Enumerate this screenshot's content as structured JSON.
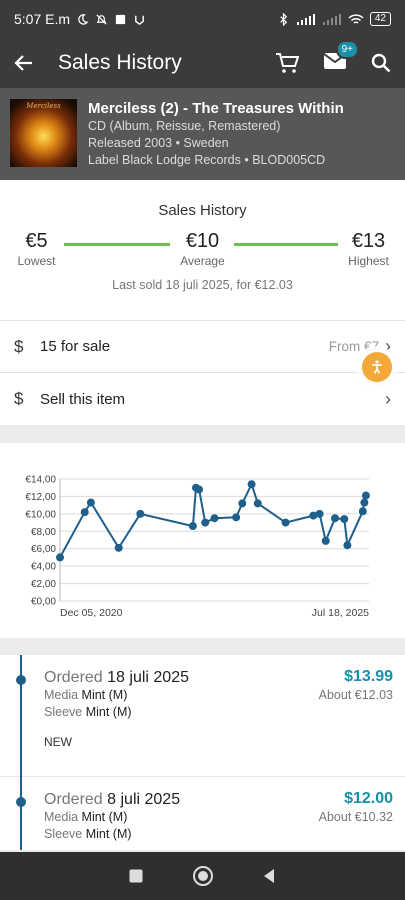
{
  "status_bar": {
    "time": "5:07 E.m",
    "battery": "42"
  },
  "app_bar": {
    "title": "Sales History",
    "cart_icon": "cart-icon",
    "inbox_icon": "inbox-icon",
    "inbox_badge": "9+",
    "search_icon": "search-icon",
    "back_icon": "back-arrow-icon"
  },
  "release": {
    "cover_logo": "Merciless",
    "title": "Merciless (2) - The Treasures Within",
    "format": "CD (Album, Reissue, Remastered)",
    "released": "Released 2003  • Sweden",
    "label": "Label Black Lodge Records • BLOD005CD"
  },
  "summary": {
    "heading": "Sales History",
    "lowest_value": "€5",
    "lowest_label": "Lowest",
    "average_value": "€10",
    "average_label": "Average",
    "highest_value": "€13",
    "highest_label": "Highest",
    "last_sold": "Last sold 18 juli 2025, for €12.03"
  },
  "rows": {
    "for_sale_icon": "$",
    "for_sale_label": "15 for sale",
    "for_sale_right": "From €7",
    "sell_icon": "$",
    "sell_label": "Sell this item"
  },
  "accent": "#1a8fa8",
  "chart_data": {
    "type": "line",
    "title": "",
    "xlabel": "",
    "ylabel": "",
    "x_tick_labels": [
      "Dec 05, 2020",
      "Jul 18, 2025"
    ],
    "y_tick_labels": [
      "€0,00",
      "€2,00",
      "€4,00",
      "€6,00",
      "€8,00",
      "€10,00",
      "€12,00",
      "€14,00"
    ],
    "ylim": [
      0,
      14
    ],
    "grid": true,
    "color": "#1f5f8b",
    "points": [
      {
        "x": 0.0,
        "y": 5.0
      },
      {
        "x": 0.08,
        "y": 10.2
      },
      {
        "x": 0.1,
        "y": 11.3
      },
      {
        "x": 0.19,
        "y": 6.1
      },
      {
        "x": 0.26,
        "y": 10.0
      },
      {
        "x": 0.43,
        "y": 8.6
      },
      {
        "x": 0.44,
        "y": 13.0
      },
      {
        "x": 0.45,
        "y": 12.8
      },
      {
        "x": 0.47,
        "y": 9.0
      },
      {
        "x": 0.5,
        "y": 9.5
      },
      {
        "x": 0.57,
        "y": 9.6
      },
      {
        "x": 0.59,
        "y": 11.2
      },
      {
        "x": 0.62,
        "y": 13.4
      },
      {
        "x": 0.64,
        "y": 11.2
      },
      {
        "x": 0.73,
        "y": 9.0
      },
      {
        "x": 0.82,
        "y": 9.8
      },
      {
        "x": 0.84,
        "y": 10.0
      },
      {
        "x": 0.86,
        "y": 6.9
      },
      {
        "x": 0.89,
        "y": 9.5
      },
      {
        "x": 0.92,
        "y": 9.4
      },
      {
        "x": 0.93,
        "y": 6.4
      },
      {
        "x": 0.98,
        "y": 10.3
      },
      {
        "x": 0.985,
        "y": 11.3
      },
      {
        "x": 0.99,
        "y": 12.1
      }
    ]
  },
  "orders": [
    {
      "ordered_label": "Ordered",
      "date": "18 juli 2025",
      "price_usd": "$13.99",
      "price_eur": "About €12.03",
      "media_label": "Media",
      "media": "Mint (M)",
      "sleeve_label": "Sleeve",
      "sleeve": "Mint (M)",
      "tag": "NEW"
    },
    {
      "ordered_label": "Ordered",
      "date": "8 juli 2025",
      "price_usd": "$12.00",
      "price_eur": "About €10.32",
      "media_label": "Media",
      "media": "Mint (M)",
      "sleeve_label": "Sleeve",
      "sleeve": "Mint (M)",
      "tag": ""
    }
  ],
  "nav": {
    "recents_icon": "recents-square-icon",
    "home_icon": "home-circle-icon",
    "back_icon": "back-triangle-icon"
  }
}
